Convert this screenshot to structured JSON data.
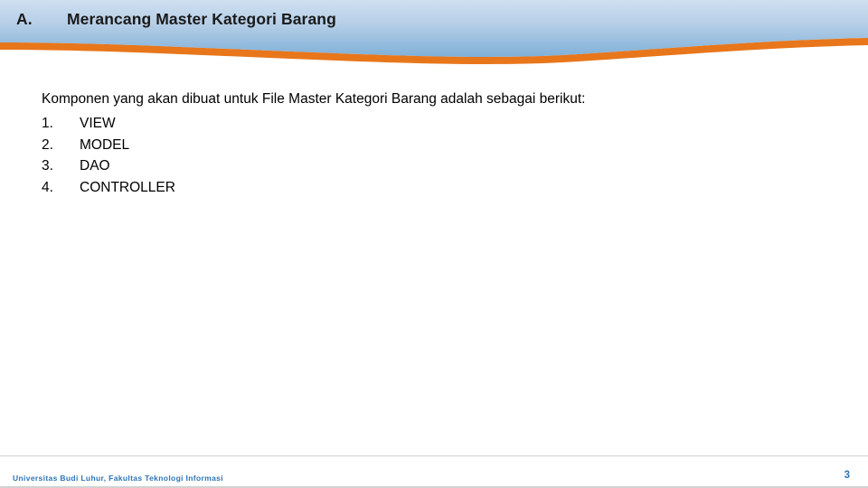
{
  "slide": {
    "header": {
      "section_letter": "A.",
      "title": "Merancang Master Kategori Barang",
      "band_top_color": "#b9d3ea",
      "band_bottom_color": "#7fafd6",
      "accent_color": "#e8761b"
    },
    "content": {
      "intro": "Komponen yang akan dibuat untuk File Master Kategori Barang adalah sebagai berikut:",
      "items": [
        {
          "number": "1.",
          "label": "VIEW"
        },
        {
          "number": "2.",
          "label": "MODEL"
        },
        {
          "number": "3.",
          "label": "DAO"
        },
        {
          "number": "4.",
          "label": "CONTROLLER"
        }
      ]
    },
    "footer": {
      "institution": "Universitas Budi Luhur, Fakultas Teknologi Informasi",
      "page_number": "3",
      "text_color": "#2e74b5"
    }
  }
}
